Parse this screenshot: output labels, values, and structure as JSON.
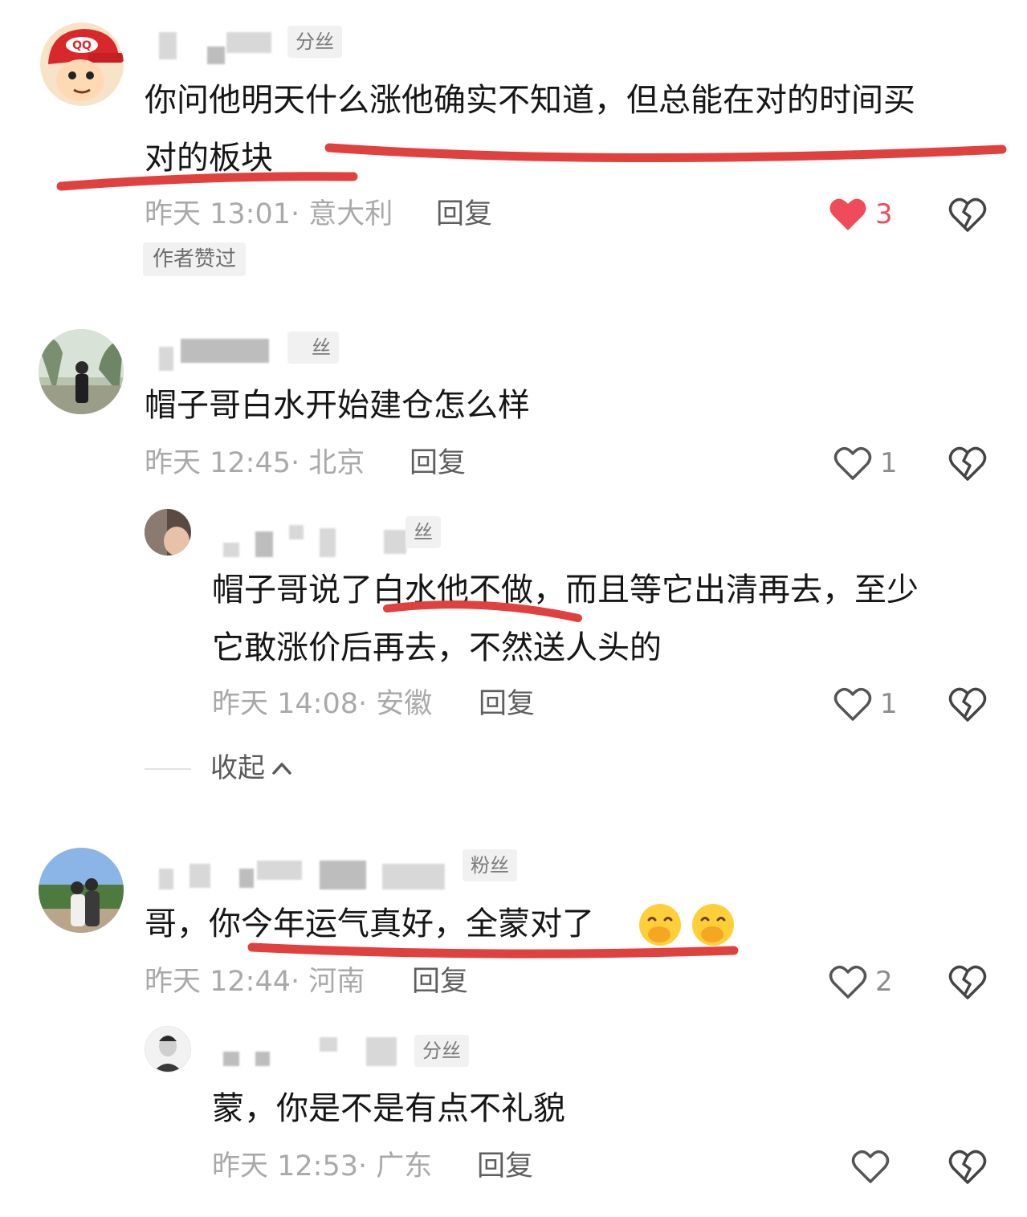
{
  "comments": [
    {
      "badge": "分丝",
      "text_line1": "你问他明天什么涨他确实不知道，但总能在对的时间买",
      "text_line2": "对的板块",
      "meta": "昨天 13:01· 意大利",
      "reply_label": "回复",
      "like_count": "3",
      "liked": true,
      "author_tag": "作者赞过"
    },
    {
      "badge": "丝",
      "text": "帽子哥白水开始建仓怎么样",
      "meta": "昨天 12:45· 北京",
      "reply_label": "回复",
      "like_count": "1"
    },
    {
      "badge": "丝",
      "text_line1": "帽子哥说了白水他不做，而且等它出清再去，至少",
      "text_line2": "它敢涨价后再去，不然送人头的",
      "meta": "昨天 14:08· 安徽",
      "reply_label": "回复",
      "like_count": "1"
    },
    {
      "badge": "粉丝",
      "text": "哥，你今年运气真好，全蒙对了",
      "meta": "昨天 12:44· 河南",
      "reply_label": "回复",
      "like_count": "2"
    },
    {
      "badge": "分丝",
      "text": "蒙，你是不是有点不礼貌",
      "meta": "昨天 12:53· 广东",
      "reply_label": "回复",
      "like_count": ""
    }
  ],
  "collapse_label": "收起",
  "colors": {
    "annotation_red": "#e0403e",
    "like_red": "#ef4b5b",
    "meta_gray": "#a9a9a9"
  },
  "icons": [
    "heart-icon",
    "heart-filled-icon",
    "broken-heart-icon",
    "chevron-up-icon",
    "hand-over-mouth-emoji"
  ]
}
